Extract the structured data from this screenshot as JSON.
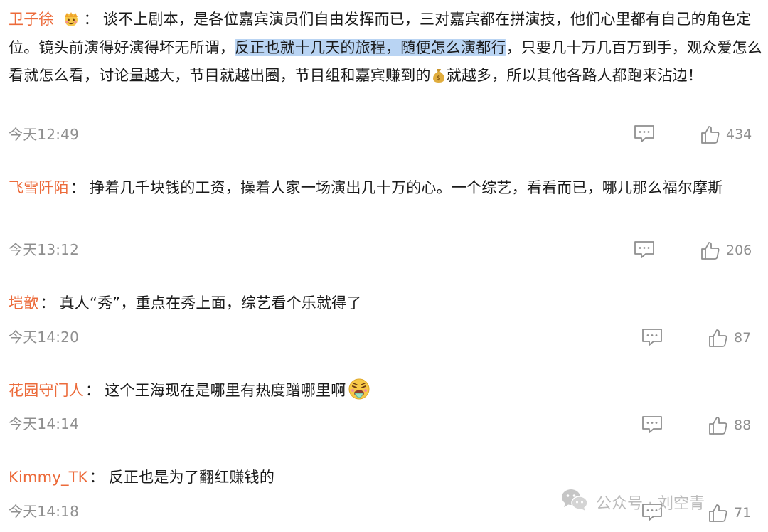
{
  "comments": [
    {
      "user": "卫子徐",
      "badge_icon": "crown-badge-icon",
      "text_before": "谈不上剧本，是各位嘉宾演员们自由发挥而已，三对嘉宾都在拼演技，他们心里都有自己的角色定位。镜头前演得好演得坏无所谓，",
      "text_highlight": "反正也就十几天的旅程，随便怎么演都行",
      "text_mid": "，只要几十万几百万到手，观众爱怎么看就怎么看，讨论量越大，节目就越出圈，节目组和嘉宾赚到的",
      "inline_icon": "money-bag-icon",
      "text_after": "就越多，所以其他各路人都跑来沾边！",
      "time": "今天12:49",
      "likes": "434"
    },
    {
      "user": "飞雪阡陌",
      "text": "挣着几千块钱的工资，操着人家一场演出几十万的心。一个综艺，看看而已，哪儿那么福尔摩斯",
      "time": "今天13:12",
      "likes": "206"
    },
    {
      "user": "垲歆",
      "text": "真人“秀”，重点在秀上面，综艺看个乐就得了",
      "time": "今天14:20",
      "likes": "87"
    },
    {
      "user": "花园守门人",
      "text": "这个王海现在是哪里有热度蹭哪里啊",
      "inline_icon": "vomit-face-emoji-icon",
      "time": "今天14:14",
      "likes": "88"
    },
    {
      "user": "Kimmy_TK",
      "text": "反正也是为了翻红赚钱的",
      "time": "今天14:18",
      "likes": "71"
    }
  ],
  "separator": "：",
  "watermark": {
    "text": "公众号 · 刘空青"
  },
  "colors": {
    "username": "#ec6b3b",
    "highlight": "#b9d4f3",
    "meta": "#8f8f8f",
    "text": "#1a1a1a"
  }
}
